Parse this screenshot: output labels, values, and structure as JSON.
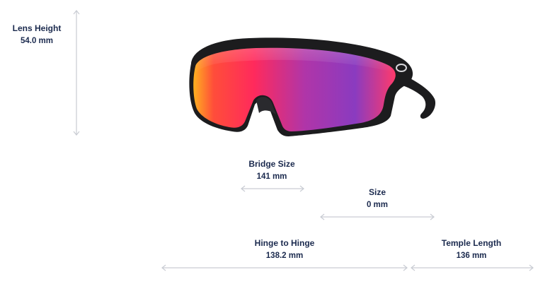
{
  "measurements": {
    "lens_height": {
      "label": "Lens Height",
      "value": "54.0 mm"
    },
    "bridge_size": {
      "label": "Bridge Size",
      "value": "141 mm"
    },
    "size": {
      "label": "Size",
      "value": "0 mm"
    },
    "hinge_to_hinge": {
      "label": "Hinge to Hinge",
      "value": "138.2 mm"
    },
    "temple_length": {
      "label": "Temple Length",
      "value": "136 mm"
    }
  },
  "colors": {
    "text": "#1b2a4e",
    "arrow": "#c9ccd3",
    "frame": "#1c1c1e",
    "lens_red": "#ff2a4f",
    "lens_purple": "#7d3fb8"
  },
  "product_image": {
    "icon": "sunglasses-icon"
  }
}
